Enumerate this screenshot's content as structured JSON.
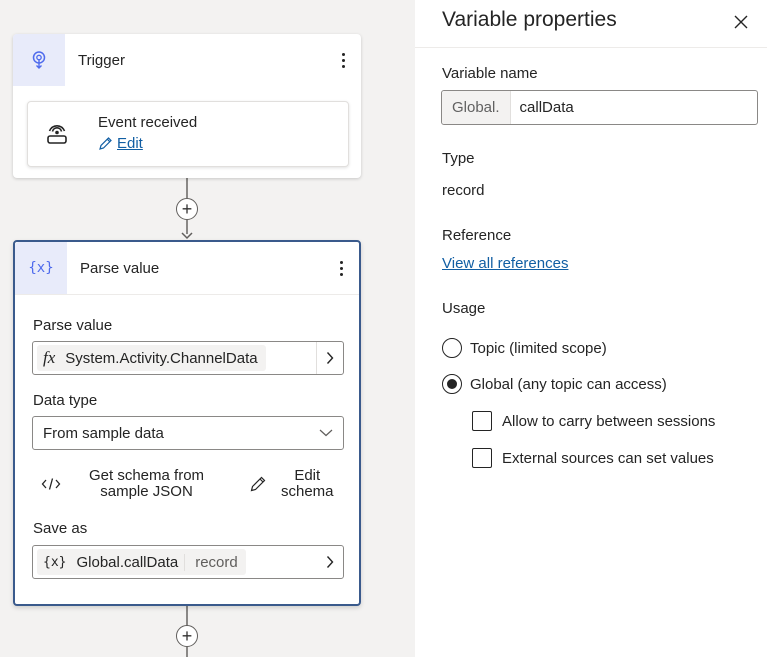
{
  "canvas": {
    "trigger_node": {
      "title": "Trigger",
      "event_card": {
        "title": "Event received",
        "edit_label": "Edit"
      }
    },
    "parse_node": {
      "title": "Parse value",
      "icon_text": "{x}",
      "parse_value_label": "Parse value",
      "parse_value_expression": "System.Activity.ChannelData",
      "data_type_label": "Data type",
      "data_type_selected": "From sample data",
      "get_schema_line1": "Get schema from",
      "get_schema_line2": "sample JSON",
      "edit_schema_line1": "Edit",
      "edit_schema_line2": "schema",
      "save_as_label": "Save as",
      "save_as_icon_text": "{x}",
      "save_as_variable": "Global.callData",
      "save_as_type": "record"
    },
    "add_step_symbol": "+"
  },
  "panel": {
    "title": "Variable properties",
    "variable_name_label": "Variable name",
    "variable_prefix": "Global.",
    "variable_name_value": "callData",
    "type_label": "Type",
    "type_value": "record",
    "reference_label": "Reference",
    "view_references_link": "View all references",
    "usage_label": "Usage",
    "usage_options": [
      {
        "label": "Topic (limited scope)",
        "selected": false
      },
      {
        "label": "Global (any topic can access)",
        "selected": true
      }
    ],
    "global_options": [
      {
        "label": "Allow to carry between sessions",
        "checked": false
      },
      {
        "label": "External sources can set values",
        "checked": false
      }
    ]
  },
  "colors": {
    "canvas_background": "#f3f2f1",
    "accent_link": "#115ea3",
    "node_icon_bg": "#e8ebfa",
    "node_icon_fg": "#4f6bed",
    "selected_node_border": "#3a5a8c"
  },
  "icons": {
    "trigger": "trigger-icon",
    "event": "event-broadcast-icon",
    "edit": "pencil-icon",
    "variable": "variable-braces-icon",
    "formula": "fx-icon",
    "chevron_right": "chevron-right-icon",
    "chevron_down": "chevron-down-icon",
    "code": "code-icon",
    "close": "close-icon",
    "add": "plus-icon",
    "more": "more-vertical-icon"
  }
}
